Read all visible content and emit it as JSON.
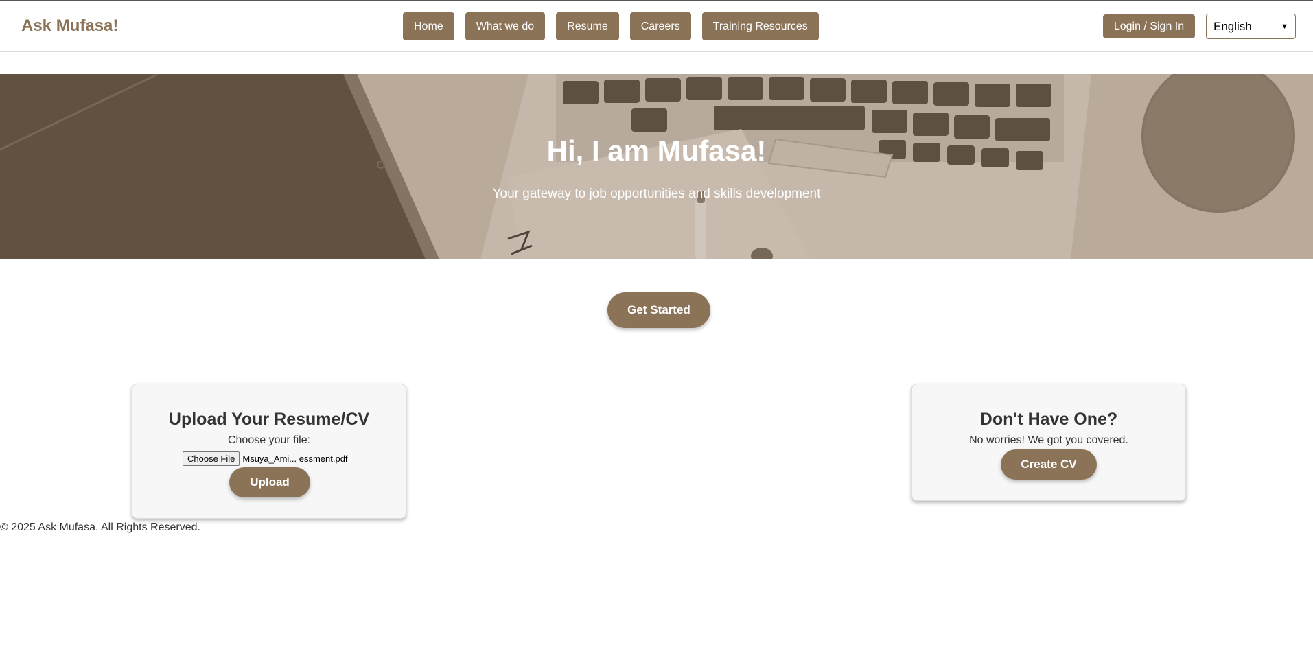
{
  "header": {
    "brand": "Ask Mufasa!",
    "nav": [
      {
        "label": "Home"
      },
      {
        "label": "What we do"
      },
      {
        "label": "Resume"
      },
      {
        "label": "Careers"
      },
      {
        "label": "Training Resources"
      }
    ],
    "login_label": "Login / Sign In",
    "language": {
      "selected": "English"
    }
  },
  "hero": {
    "title": "Hi, I am Mufasa!",
    "subtitle": "Your gateway to job opportunities and skills development"
  },
  "cta": {
    "get_started_label": "Get Started"
  },
  "upload_card": {
    "title": "Upload Your Resume/CV",
    "choose_label": "Choose your file:",
    "file_button_label": "Choose File",
    "file_name": "Msuya_Ami... essment.pdf",
    "upload_label": "Upload"
  },
  "create_card": {
    "title": "Don't Have One?",
    "text": "No worries! We got you covered.",
    "create_label": "Create CV"
  },
  "footer": {
    "copyright": "© 2025 Ask Mufasa. All Rights Reserved."
  },
  "colors": {
    "accent": "#8b7357",
    "text": "#333333",
    "card_bg": "#f7f7f7"
  },
  "icons": {
    "language_dropdown": "chevron-down-icon",
    "hero_background": "laptop-desk-photo"
  }
}
